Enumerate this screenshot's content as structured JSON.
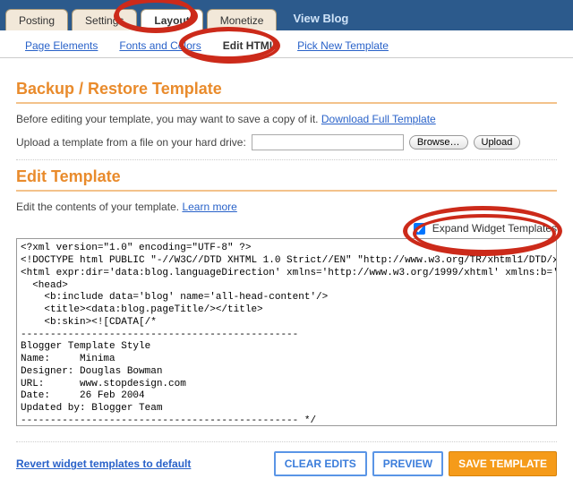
{
  "topTabs": {
    "t0": "Posting",
    "t1": "Settings",
    "t2": "Layout",
    "t3": "Monetize",
    "view": "View Blog"
  },
  "subTabs": {
    "s0": "Page Elements",
    "s1": "Fonts and Colors",
    "s2": "Edit HTML",
    "s3": "Pick New Template"
  },
  "backup": {
    "heading": "Backup / Restore Template",
    "intro": "Before editing your template, you may want to save a copy of it. ",
    "download": "Download Full Template",
    "uploadLabel": "Upload a template from a file on your hard drive:",
    "browse": "Browse…",
    "upload": "Upload"
  },
  "edit": {
    "heading": "Edit Template",
    "intro": "Edit the contents of your template. ",
    "learn": "Learn more",
    "expand": "Expand Widget Templates",
    "code": "<?xml version=\"1.0\" encoding=\"UTF-8\" ?>\n<!DOCTYPE html PUBLIC \"-//W3C//DTD XHTML 1.0 Strict//EN\" \"http://www.w3.org/TR/xhtml1/DTD/xhtml1-strict.dtd\">\n<html expr:dir='data:blog.languageDirection' xmlns='http://www.w3.org/1999/xhtml' xmlns:b='http://www.google.com/2005/gml/b' xmlns:data='http://www.google.com/2005/gml/data' xmlns:expr='http://www.google.com/2005/gml/expr'>\n  <head>\n    <b:include data='blog' name='all-head-content'/>\n    <title><data:blog.pageTitle/></title>\n    <b:skin><![CDATA[/*\n-----------------------------------------------\nBlogger Template Style\nName:     Minima\nDesigner: Douglas Bowman\nURL:      www.stopdesign.com\nDate:     26 Feb 2004\nUpdated by: Blogger Team\n----------------------------------------------- */\n\n/* Variable definitions\n"
  },
  "bottom": {
    "revert": "Revert widget templates to default",
    "clear": "CLEAR EDITS",
    "preview": "PREVIEW",
    "save": "SAVE TEMPLATE"
  }
}
